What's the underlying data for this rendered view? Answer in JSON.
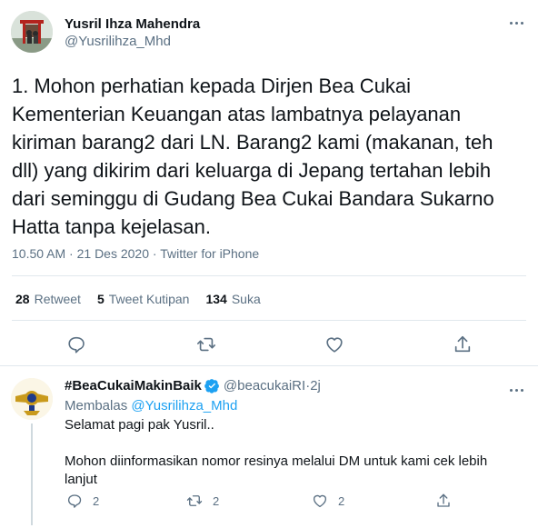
{
  "tweet": {
    "author_name": "Yusril Ihza Mahendra",
    "author_handle": "@Yusrilihza_Mhd",
    "text": "1. Mohon perhatian kepada Dirjen Bea Cukai\nKementerian Keuangan atas lambatnya pelayanan\nkiriman barang2 dari LN. Barang2 kami (makanan, teh\ndll) yang dikirim dari keluarga di Jepang tertahan lebih\ndari seminggu di Gudang Bea Cukai Bandara Sukarno\nHatta tanpa kejelasan.",
    "time": "10.50 AM",
    "date": "21 Des 2020",
    "source": "Twitter for iPhone",
    "separator": " · ",
    "stats": {
      "retweets": {
        "count": "28",
        "label": "Retweet"
      },
      "quotes": {
        "count": "5",
        "label": "Tweet Kutipan"
      },
      "likes": {
        "count": "134",
        "label": "Suka"
      }
    },
    "icons": [
      "reply-icon",
      "retweet-icon",
      "like-icon",
      "share-icon"
    ]
  },
  "reply": {
    "author_name": "#BeaCukaiMakinBaik",
    "author_handle": "@beacukaiRI",
    "separator": " · ",
    "time": "2j",
    "replying_prefix": "Membalas ",
    "replying_to": "@Yusrilihza_Mhd",
    "line1": "Selamat pagi pak Yusril..",
    "line2": "Mohon diinformasikan nomor resinya melalui DM untuk kami cek lebih lanjut",
    "counts": {
      "reply": "2",
      "retweet": "2",
      "like": "2"
    }
  },
  "colors": {
    "accent": "#1da1f2",
    "secondary_text": "#5b7083",
    "divider": "#e1e8ed"
  }
}
